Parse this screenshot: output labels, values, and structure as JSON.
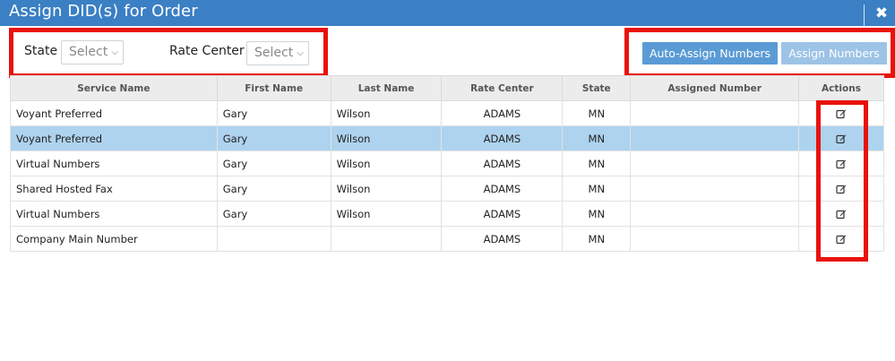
{
  "dialog": {
    "title": "Assign DID(s) for Order",
    "close_label": "✖"
  },
  "filters": {
    "state_label": "State",
    "state_value": "Select",
    "rate_center_label": "Rate Center",
    "rate_center_value": "Select"
  },
  "buttons": {
    "auto_assign": "Auto-Assign Numbers",
    "assign": "Assign Numbers"
  },
  "table": {
    "columns": [
      "Service Name",
      "First Name",
      "Last Name",
      "Rate Center",
      "State",
      "Assigned Number",
      "Actions"
    ],
    "rows": [
      [
        "Voyant Preferred",
        "Gary",
        "Wilson",
        "ADAMS",
        "MN",
        ""
      ],
      [
        "Voyant Preferred",
        "Gary",
        "Wilson",
        "ADAMS",
        "MN",
        ""
      ],
      [
        "Virtual Numbers",
        "Gary",
        "Wilson",
        "ADAMS",
        "MN",
        ""
      ],
      [
        "Shared Hosted Fax",
        "Gary",
        "Wilson",
        "ADAMS",
        "MN",
        ""
      ],
      [
        "Virtual Numbers",
        "Gary",
        "Wilson",
        "ADAMS",
        "MN",
        ""
      ],
      [
        "Company Main Number",
        "",
        "",
        "ADAMS",
        "MN",
        ""
      ]
    ],
    "selected_row": 1,
    "action_icon": "edit-icon"
  },
  "colors": {
    "titlebar": "#3b7fc4",
    "highlight_border": "#e8120c",
    "selected_row": "#aed3ef",
    "button_primary": "#5b9bd5",
    "button_disabled": "#9dc3e6"
  }
}
